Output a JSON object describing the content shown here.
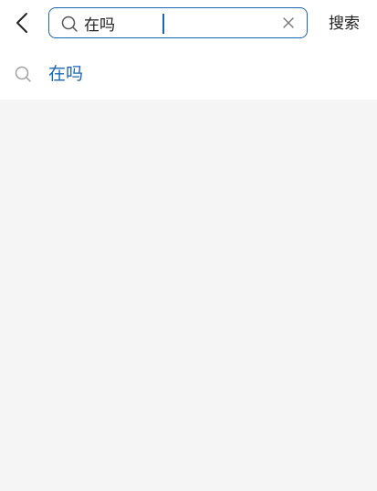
{
  "header": {
    "back_icon": "chevron-left-icon",
    "search": {
      "value": "在吗",
      "placeholder": "",
      "search_icon": "search-icon",
      "clear_icon": "close-icon"
    },
    "search_button_label": "搜索"
  },
  "suggestions": [
    {
      "label": "在吗",
      "icon": "search-icon"
    }
  ],
  "colors": {
    "accent": "#1a66b3",
    "background": "#f5f5f5",
    "surface": "#ffffff",
    "text": "#222222",
    "icon_muted": "#a0a0a0"
  }
}
